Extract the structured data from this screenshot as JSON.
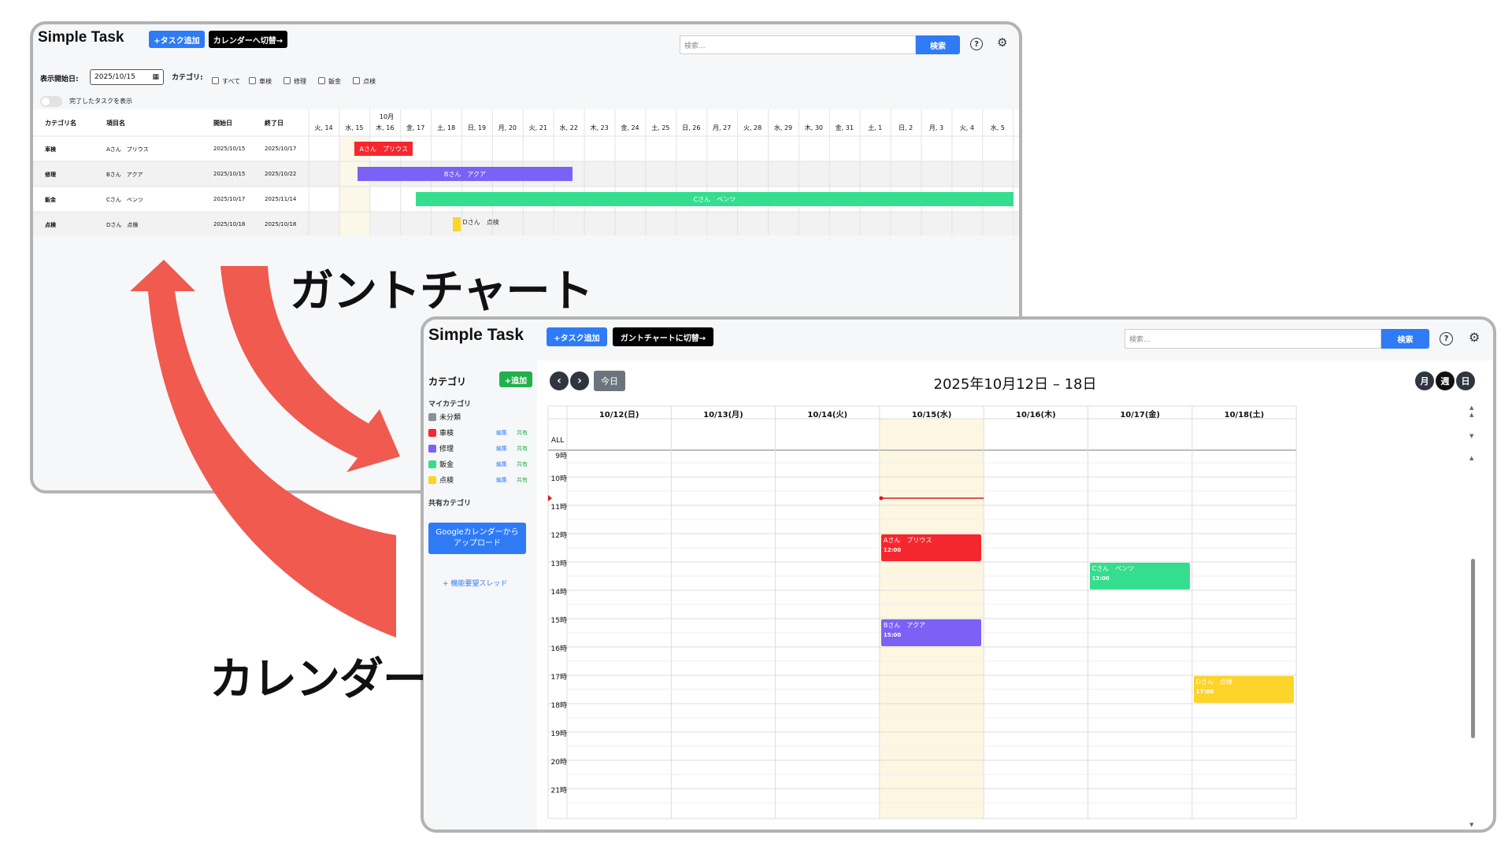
{
  "labels": {
    "gantt_caption": "ガントチャート",
    "calendar_caption": "カレンダー"
  },
  "gantt": {
    "app_title": "Simple Task",
    "add_task": "+タスク追加",
    "switch_calendar": "カレンダーへ切替→",
    "search_placeholder": "検索...",
    "search_button": "検索",
    "help_icon": "?",
    "start_date_label": "表示開始日:",
    "start_date_value": "2025/10/15",
    "category_label": "カテゴリ:",
    "filters": [
      "すべて",
      "車検",
      "修理",
      "鈑金",
      "点検"
    ],
    "show_completed": "完了したタスクを表示",
    "columns": [
      "カテゴリ名",
      "項目名",
      "開始日",
      "終了日"
    ],
    "month_label": "10月",
    "days": [
      "火, 14",
      "水, 15",
      "木, 16",
      "金, 17",
      "土, 18",
      "日, 19",
      "月, 20",
      "火, 21",
      "水, 22",
      "木, 23",
      "金, 24",
      "土, 25",
      "日, 26",
      "月, 27",
      "火, 28",
      "水, 29",
      "木, 30",
      "金, 31",
      "土, 1",
      "日, 2",
      "月, 3",
      "火, 4",
      "水, 5"
    ],
    "rows": [
      {
        "category": "車検",
        "item": "Aさん　プリウス",
        "start": "2025/10/15",
        "end": "2025/10/17",
        "bar": "Aさん　プリウス",
        "color": "#f5272e"
      },
      {
        "category": "修理",
        "item": "Bさん　アクア",
        "start": "2025/10/15",
        "end": "2025/10/22",
        "bar": "Bさん　アクア",
        "color": "#7b61f5"
      },
      {
        "category": "鈑金",
        "item": "Cさん　ベンツ",
        "start": "2025/10/17",
        "end": "2025/11/14",
        "bar": "Cさん　ベンツ",
        "color": "#35dd8e"
      },
      {
        "category": "点検",
        "item": "Dさん　点検",
        "start": "2025/10/18",
        "end": "2025/10/18",
        "bar": "Dさん　点検",
        "color": "#fcd42a"
      }
    ]
  },
  "calendar": {
    "app_title": "Simple Task",
    "add_task": "+タスク追加",
    "switch_gantt": "ガントチャートに切替→",
    "search_placeholder": "検索...",
    "search_button": "検索",
    "help_icon": "?",
    "sidebar_title": "カテゴリ",
    "add_button": "+追加",
    "my_categories": "マイカテゴリ",
    "categories": [
      {
        "name": "未分類",
        "color": "#8a8f98",
        "edit": "",
        "share": ""
      },
      {
        "name": "車検",
        "color": "#f5272e",
        "edit": "編集",
        "share": "共有"
      },
      {
        "name": "修理",
        "color": "#7b61f5",
        "edit": "編集",
        "share": "共有"
      },
      {
        "name": "鈑金",
        "color": "#35dd8e",
        "edit": "編集",
        "share": "共有"
      },
      {
        "name": "点検",
        "color": "#fcd42a",
        "edit": "編集",
        "share": "共有"
      }
    ],
    "shared_categories": "共有カテゴリ",
    "google_upload_line1": "Googleカレンダーから",
    "google_upload_line2": "アップロード",
    "feature_request": "+ 機能要望スレッド",
    "today_button": "今日",
    "range_title": "2025年10月12日 – 18日",
    "views": [
      "月",
      "週",
      "日"
    ],
    "allday_label": "ALL",
    "days": [
      "10/12(日)",
      "10/13(月)",
      "10/14(火)",
      "10/15(水)",
      "10/16(木)",
      "10/17(金)",
      "10/18(土)"
    ],
    "hours": [
      "9時",
      "10時",
      "11時",
      "12時",
      "13時",
      "14時",
      "15時",
      "16時",
      "17時",
      "18時",
      "19時",
      "20時",
      "21時"
    ],
    "events": [
      {
        "title": "Aさん　プリウス",
        "time": "12:00",
        "color": "#f5272e",
        "day": 3,
        "hour": 12
      },
      {
        "title": "Cさん　ベンツ",
        "time": "13:00",
        "color": "#35dd8e",
        "day": 5,
        "hour": 13
      },
      {
        "title": "Bさん　アクア",
        "time": "15:00",
        "color": "#7b61f5",
        "day": 3,
        "hour": 15
      },
      {
        "title": "Dさん　点検",
        "time": "17:00",
        "color": "#fcd42a",
        "day": 6,
        "hour": 17
      }
    ]
  }
}
